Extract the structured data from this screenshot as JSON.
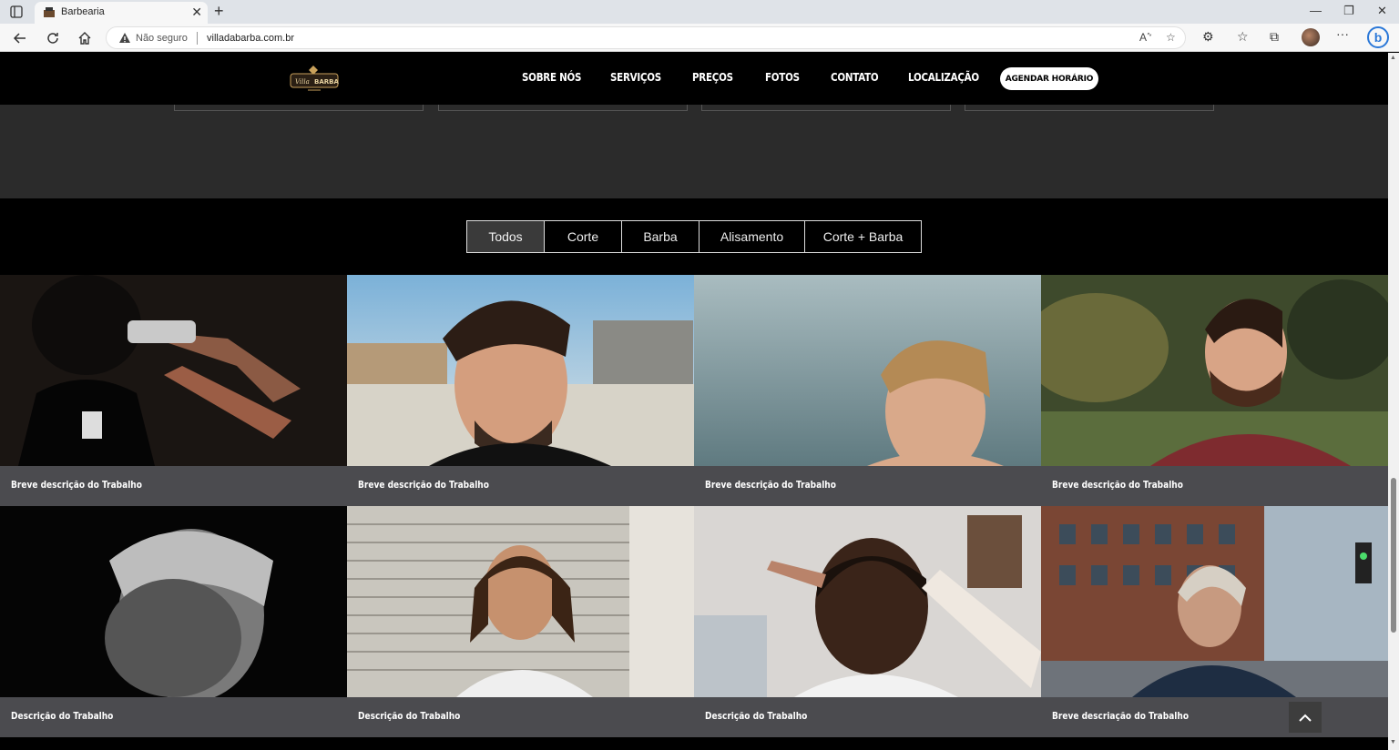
{
  "browser": {
    "tab_title": "Barbearia",
    "security_label": "Não seguro",
    "url": "villadabarba.com.br"
  },
  "site": {
    "logo_text": "Villa da Barba",
    "nav": [
      "SOBRE NÓS",
      "SERVIÇOS",
      "PREÇOS",
      "FOTOS",
      "CONTATO",
      "LOCALIZAÇÃO"
    ],
    "cta": "AGENDAR HORÁRIO"
  },
  "filters": [
    {
      "label": "Todos",
      "active": true
    },
    {
      "label": "Corte",
      "active": false
    },
    {
      "label": "Barba",
      "active": false
    },
    {
      "label": "Alisamento",
      "active": false
    },
    {
      "label": "Corte + Barba",
      "active": false
    }
  ],
  "gallery": [
    {
      "caption": "Breve descrição do Trabalho",
      "icon": "barber-clipper-photo"
    },
    {
      "caption": "Breve descrição do Trabalho",
      "icon": "man-undercut-beach-photo"
    },
    {
      "caption": "Breve descrição do Trabalho",
      "icon": "man-quiff-sea-photo"
    },
    {
      "caption": "Breve descrição do Trabalho",
      "icon": "man-beard-forest-photo"
    },
    {
      "caption": "Descrição do Trabalho",
      "icon": "man-profile-bw-photo"
    },
    {
      "caption": "Descrição do Trabalho",
      "icon": "man-dreadlocks-photo"
    },
    {
      "caption": "Descrição do Trabalho",
      "icon": "fade-haircut-photo"
    },
    {
      "caption": "Breve descriação do Trabalho",
      "icon": "man-city-street-photo"
    }
  ],
  "colors": {
    "header_bg": "#000000",
    "band_bg": "#2b2b2b",
    "caption_bg": "#4b4b4f",
    "active_filter_bg": "#3a3a3a"
  }
}
